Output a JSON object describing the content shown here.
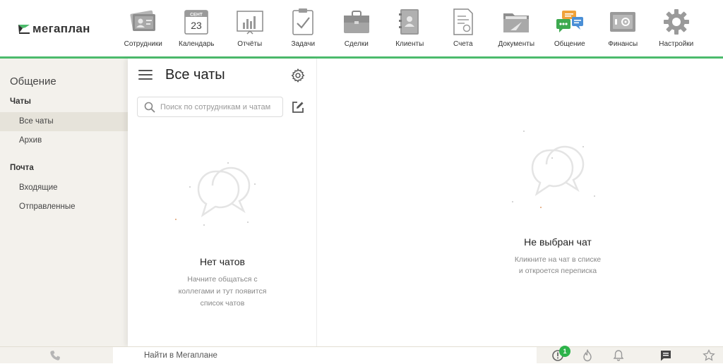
{
  "app": {
    "logo_text": "мегаплан",
    "brand_color": "#4cbb6c",
    "active_section": "Общение"
  },
  "nav": {
    "items": [
      {
        "label": "Сотрудники",
        "icon": "employees-icon"
      },
      {
        "label": "Календарь",
        "icon": "calendar-icon",
        "month": "СЕНТ",
        "day": "23"
      },
      {
        "label": "Отчёты",
        "icon": "reports-icon"
      },
      {
        "label": "Задачи",
        "icon": "tasks-icon"
      },
      {
        "label": "Сделки",
        "icon": "deals-icon"
      },
      {
        "label": "Клиенты",
        "icon": "clients-icon"
      },
      {
        "label": "Счета",
        "icon": "invoices-icon"
      },
      {
        "label": "Документы",
        "icon": "documents-icon"
      },
      {
        "label": "Общение",
        "icon": "chat-icon"
      },
      {
        "label": "Финансы",
        "icon": "finance-icon"
      },
      {
        "label": "Настройки",
        "icon": "settings-icon"
      }
    ]
  },
  "sidebar": {
    "title": "Общение",
    "sections": [
      {
        "title": "Чаты",
        "items": [
          {
            "label": "Все чаты",
            "active": true
          },
          {
            "label": "Архив"
          }
        ]
      },
      {
        "title": "Почта",
        "items": [
          {
            "label": "Входящие"
          },
          {
            "label": "Отправленные"
          }
        ]
      }
    ]
  },
  "chatlist": {
    "title": "Все чаты",
    "search_placeholder": "Поиск по сотрудникам и чатам",
    "empty_title": "Нет чатов",
    "empty_text": "Начните общаться с коллегами и тут появится список чатов"
  },
  "main": {
    "empty_title": "Не выбран чат",
    "empty_text_line1": "Кликните на чат в списке",
    "empty_text_line2": "и откроется переписка"
  },
  "bottombar": {
    "search_placeholder": "Найти в Мегаплане",
    "notification_count": "1",
    "icons": [
      "phone-icon",
      "alert-icon",
      "fire-icon",
      "bell-icon",
      "message-icon",
      "star-icon"
    ]
  }
}
